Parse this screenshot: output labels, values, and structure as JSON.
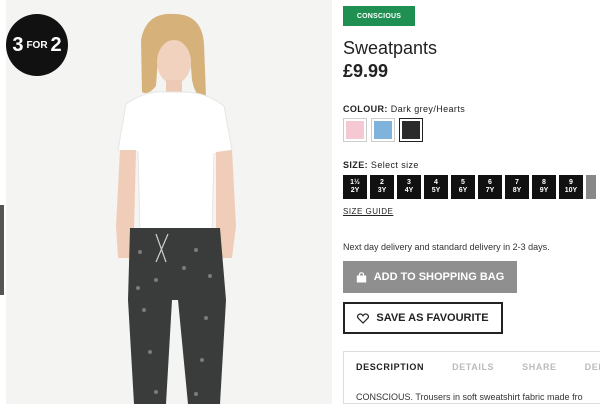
{
  "promo": {
    "big1": "3",
    "small": "FOR",
    "big2": "2"
  },
  "product": {
    "tag": "CONSCIOUS",
    "title": "Sweatpants",
    "price": "£9.99"
  },
  "colour": {
    "label": "COLOUR:",
    "value": "Dark grey/Hearts",
    "swatches": [
      {
        "name": "light-pink",
        "color": "#f5c9d4"
      },
      {
        "name": "light-blue",
        "color": "#7fb3dc"
      },
      {
        "name": "dark-grey",
        "color": "#2b2b2b"
      }
    ]
  },
  "size": {
    "label": "SIZE:",
    "value": "Select size",
    "options": [
      {
        "top": "1½",
        "bottom": "2Y"
      },
      {
        "top": "2",
        "bottom": "3Y"
      },
      {
        "top": "3",
        "bottom": "4Y"
      },
      {
        "top": "4",
        "bottom": "5Y"
      },
      {
        "top": "5",
        "bottom": "6Y"
      },
      {
        "top": "6",
        "bottom": "7Y"
      },
      {
        "top": "7",
        "bottom": "8Y"
      },
      {
        "top": "8",
        "bottom": "9Y"
      },
      {
        "top": "9",
        "bottom": "10Y"
      }
    ],
    "guide": "SIZE GUIDE"
  },
  "delivery": "Next day delivery and standard delivery in 2-3 days.",
  "buttons": {
    "add": "ADD TO SHOPPING BAG",
    "favourite": "SAVE AS FAVOURITE"
  },
  "tabs": [
    "DESCRIPTION",
    "DETAILS",
    "SHARE",
    "DELI"
  ],
  "description": "CONSCIOUS. Trousers in soft sweatshirt fabric made fro"
}
